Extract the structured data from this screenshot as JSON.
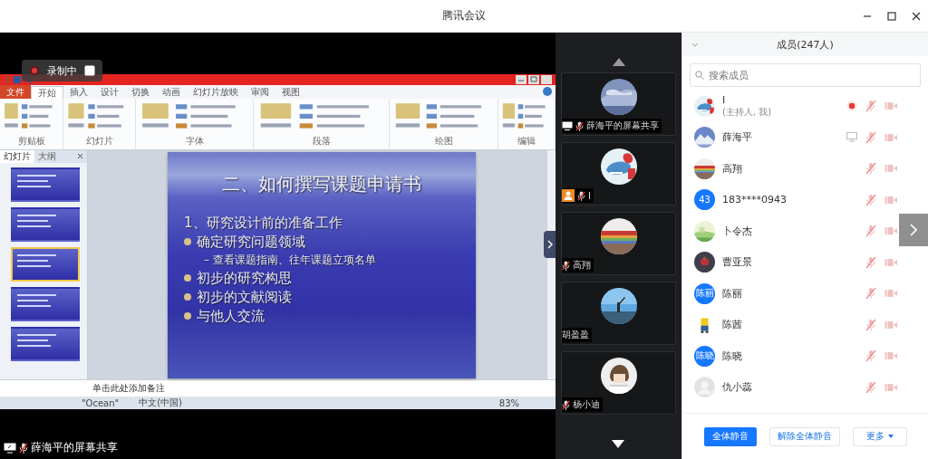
{
  "window": {
    "title": "腾讯会议"
  },
  "recording": {
    "label": "录制中"
  },
  "shared_screen": {
    "app_tabs": [
      {
        "label": "文件",
        "selected": false,
        "kind": "file"
      },
      {
        "label": "开始",
        "selected": true,
        "kind": "tab"
      },
      {
        "label": "插入",
        "selected": false,
        "kind": "tab"
      },
      {
        "label": "设计",
        "selected": false,
        "kind": "tab"
      },
      {
        "label": "切换",
        "selected": false,
        "kind": "tab"
      },
      {
        "label": "动画",
        "selected": false,
        "kind": "tab"
      },
      {
        "label": "幻灯片放映",
        "selected": false,
        "kind": "tab"
      },
      {
        "label": "审阅",
        "selected": false,
        "kind": "tab"
      },
      {
        "label": "视图",
        "selected": false,
        "kind": "tab"
      }
    ],
    "ribbon_groups": [
      "剪贴板",
      "幻灯片",
      "字体",
      "段落",
      "绘图",
      "编辑"
    ],
    "pane_tabs": [
      {
        "label": "幻灯片",
        "selected": true
      },
      {
        "label": "大纲",
        "selected": false
      }
    ],
    "thumbnails": [
      {
        "selected": false
      },
      {
        "selected": false
      },
      {
        "selected": true
      },
      {
        "selected": false
      },
      {
        "selected": false
      }
    ],
    "slide": {
      "title": "二、如何撰写课题申请书",
      "lines": [
        {
          "kind": "heading",
          "text": "1、研究设计前的准备工作"
        },
        {
          "kind": "bullet",
          "text": "确定研究问题领域"
        },
        {
          "kind": "sub",
          "text": "– 查看课题指南、往年课题立项名单"
        },
        {
          "kind": "bullet",
          "text": "初步的研究构思"
        },
        {
          "kind": "bullet",
          "text": "初步的文献阅读"
        },
        {
          "kind": "bullet",
          "text": "与他人交流"
        }
      ]
    },
    "notes_placeholder": "单击此处添加备注",
    "status": [
      "\"Ocean\"",
      "中文(中国)"
    ],
    "zoom": "83%"
  },
  "share_label": "薛海平的屏幕共享",
  "video_tiles": [
    {
      "name": "薛海平的屏幕共享",
      "sharing": true,
      "host": false,
      "muted": true
    },
    {
      "name": "I",
      "sharing": false,
      "host": true,
      "muted": true
    },
    {
      "name": "高翔",
      "sharing": false,
      "host": false,
      "muted": true
    },
    {
      "name": "胡盈盈",
      "sharing": false,
      "host": false,
      "muted": false
    },
    {
      "name": "杨小迪",
      "sharing": false,
      "host": false,
      "muted": true
    }
  ],
  "panel": {
    "title": "成员(247人)",
    "search_placeholder": "搜索成员",
    "members": [
      {
        "name": "I",
        "note": "(主持人, 我)",
        "recording": true,
        "sharing": false,
        "muted": true,
        "video_on": false
      },
      {
        "name": "薛海平",
        "recording": false,
        "sharing": true,
        "muted": true,
        "video_on": false
      },
      {
        "name": "高翔",
        "recording": false,
        "sharing": false,
        "muted": true,
        "video_on": false
      },
      {
        "name": "183****0943",
        "avatar": {
          "kind": "text",
          "text": "43"
        },
        "recording": false,
        "sharing": false,
        "muted": true,
        "video_on": false
      },
      {
        "name": "卜令杰",
        "recording": false,
        "sharing": false,
        "muted": true,
        "video_on": false
      },
      {
        "name": "曹亚景",
        "recording": false,
        "sharing": false,
        "muted": true,
        "video_on": false
      },
      {
        "name": "陈丽",
        "avatar": {
          "kind": "text",
          "text": "陈丽"
        },
        "recording": false,
        "sharing": false,
        "muted": true,
        "video_on": false
      },
      {
        "name": "陈茜",
        "recording": false,
        "sharing": false,
        "muted": true,
        "video_on": false
      },
      {
        "name": "陈晓",
        "avatar": {
          "kind": "text",
          "text": "陈晓"
        },
        "recording": false,
        "sharing": false,
        "muted": true,
        "video_on": false
      },
      {
        "name": "仇小蕊",
        "avatar": {
          "kind": "default"
        },
        "recording": false,
        "sharing": false,
        "muted": true,
        "video_on": false
      }
    ],
    "buttons": [
      {
        "label": "全体静音",
        "kind": "primary"
      },
      {
        "label": "解除全体静音",
        "kind": "secondary"
      },
      {
        "label": "更多",
        "kind": "menu"
      }
    ]
  }
}
